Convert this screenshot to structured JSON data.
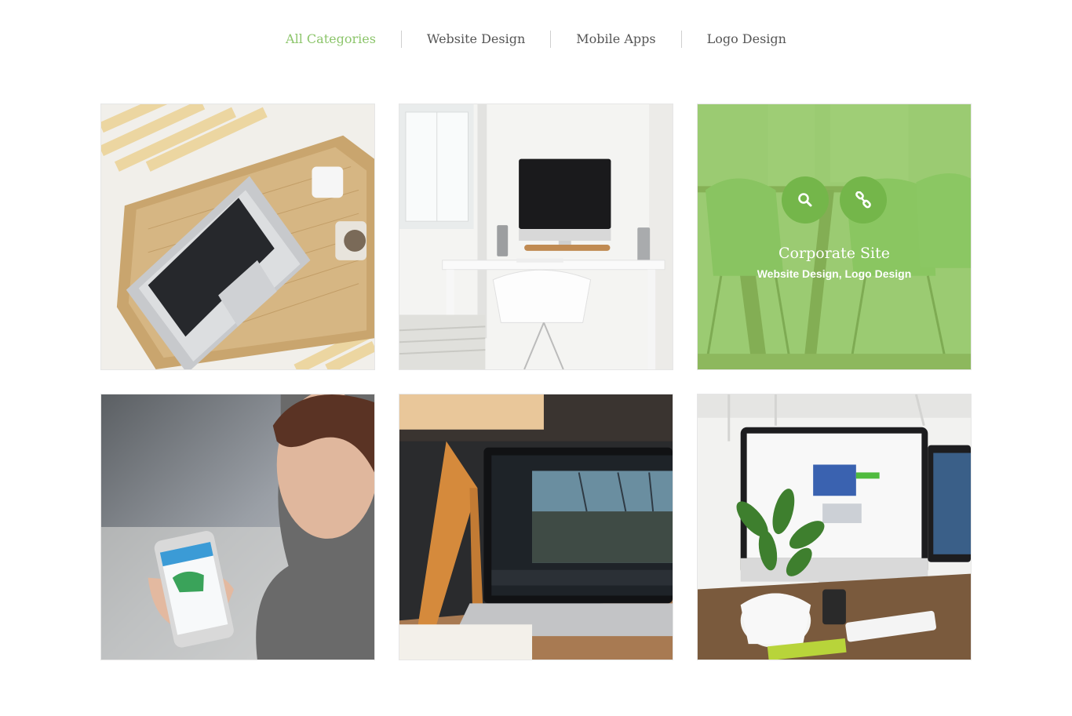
{
  "filters": [
    {
      "label": "All Categories",
      "active": true
    },
    {
      "label": "Website Design",
      "active": false
    },
    {
      "label": "Mobile Apps",
      "active": false
    },
    {
      "label": "Logo Design",
      "active": false
    }
  ],
  "accent_color": "#8cc56b",
  "portfolio": {
    "hover_item": {
      "title": "Corporate Site",
      "categories": "Website Design, Logo Design",
      "buttons": [
        {
          "icon": "search-icon"
        },
        {
          "icon": "link-icon"
        }
      ]
    },
    "items": [
      {
        "image": "laptop-on-wicker-tray-photo"
      },
      {
        "image": "imac-on-white-desk-photo"
      },
      {
        "image": "green-chairs-office-photo"
      },
      {
        "image": "woman-holding-phone-photo"
      },
      {
        "image": "laptop-photo-editing-photo"
      },
      {
        "image": "imac-with-plant-photo"
      }
    ]
  }
}
